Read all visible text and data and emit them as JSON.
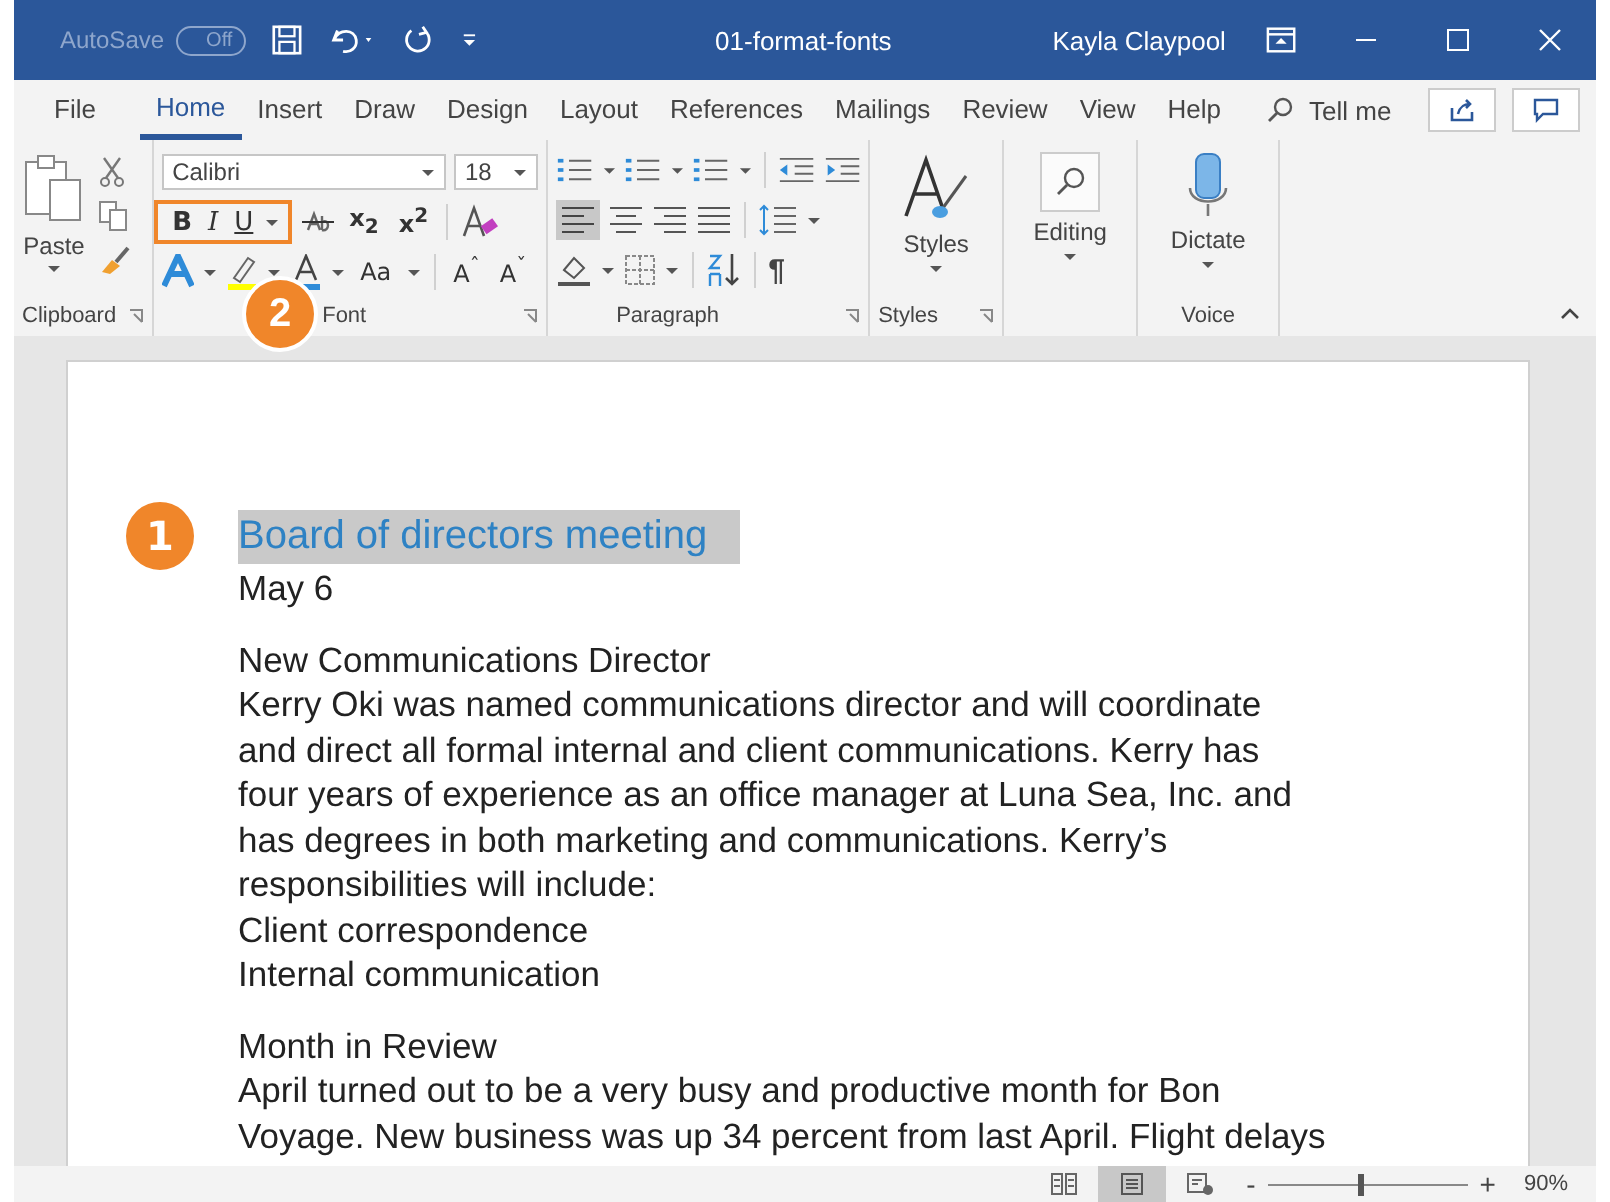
{
  "title_bar": {
    "autosave_label": "AutoSave",
    "autosave_toggle": {
      "label": "Off",
      "on": false
    },
    "document_title": "01-format-fonts",
    "user_name": "Kayla Claypool"
  },
  "menu_tabs": [
    {
      "label": "File",
      "selected": false
    },
    {
      "label": "Home",
      "selected": true
    },
    {
      "label": "Insert",
      "selected": false
    },
    {
      "label": "Draw",
      "selected": false
    },
    {
      "label": "Design",
      "selected": false
    },
    {
      "label": "Layout",
      "selected": false
    },
    {
      "label": "References",
      "selected": false
    },
    {
      "label": "Mailings",
      "selected": false
    },
    {
      "label": "Review",
      "selected": false
    },
    {
      "label": "View",
      "selected": false
    },
    {
      "label": "Help",
      "selected": false
    }
  ],
  "tell_me": "Tell me",
  "ribbon": {
    "clipboard": {
      "paste_label": "Paste",
      "group_label": "Clipboard"
    },
    "font": {
      "font_name": "Calibri",
      "font_size": "18",
      "bold": "B",
      "italic": "I",
      "underline": "U",
      "subscript": "x$_{2}$",
      "superscript": "x$^{2}$",
      "change_case": "Aa",
      "grow": "A",
      "grow_mark": "ˆ",
      "shrink": "A",
      "shrink_mark": "ˇ",
      "group_label": "Font"
    },
    "paragraph": {
      "pilcrow": "¶",
      "group_label": "Paragraph"
    },
    "styles": {
      "label": "Styles",
      "group_label": "Styles"
    },
    "editing": {
      "label": "Editing"
    },
    "voice": {
      "label": "Dictate",
      "group_label": "Voice"
    }
  },
  "callouts": [
    {
      "number": "1"
    },
    {
      "number": "2"
    }
  ],
  "document": {
    "heading": "Board of directors meeting",
    "heading_selected": true,
    "paragraphs": [
      {
        "lines": [
          "May 6"
        ]
      },
      {
        "lines": [
          "New Communications Director",
          "Kerry Oki was named communications director and will coordinate",
          "and direct all formal internal and client communications. Kerry has",
          "four years of experience as an office manager at Luna Sea, Inc. and",
          "has degrees in both marketing and communications. Kerry’s",
          "responsibilities will include:",
          "Client correspondence",
          "Internal communication"
        ]
      },
      {
        "lines": [
          "Month in Review",
          "April turned out to be a very busy and productive month for Bon",
          "Voyage. New business was up 34 percent from last April. Flight delays"
        ]
      }
    ]
  },
  "status_bar": {
    "views": [
      {
        "kind": "read",
        "selected": false
      },
      {
        "kind": "print",
        "selected": true
      },
      {
        "kind": "web",
        "selected": false
      }
    ],
    "zoom_minus": "-",
    "zoom_plus": "+",
    "zoom": {
      "level": 0.46
    },
    "zoom_percent": "90%"
  }
}
